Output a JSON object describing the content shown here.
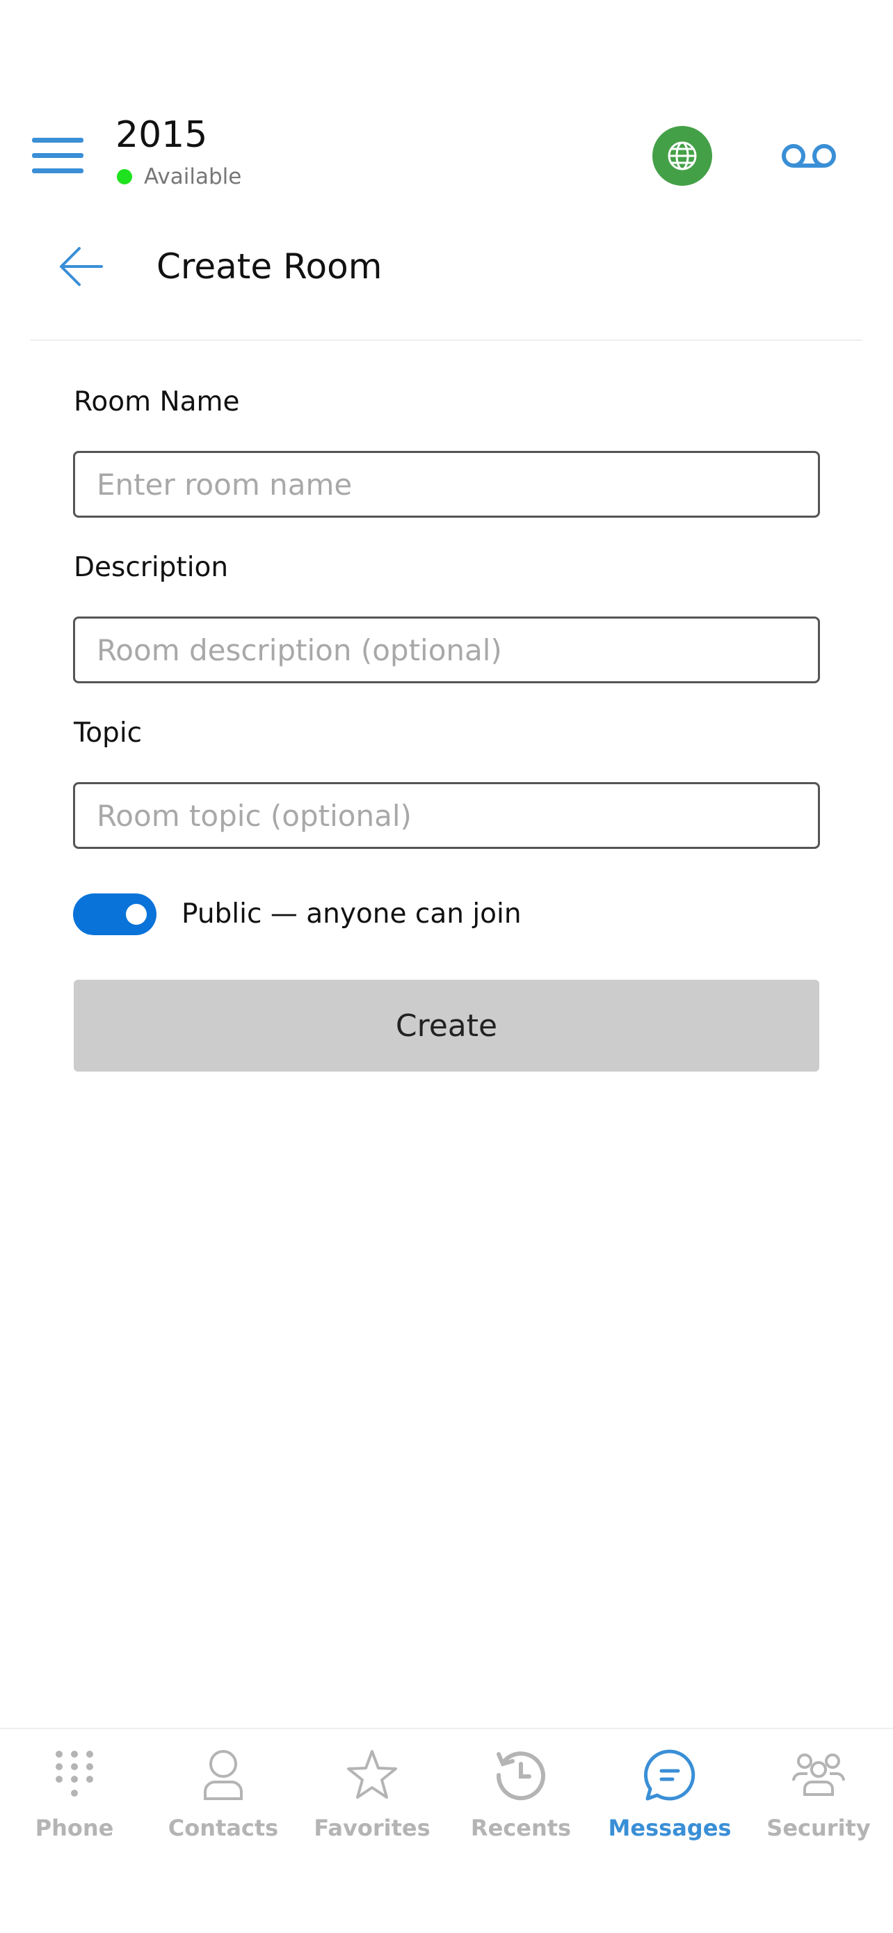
{
  "colors": {
    "accent": "#3a8fd6",
    "status_available": "#1fe21f",
    "globe_bg": "#44a047",
    "toggle_on": "#0a73d9",
    "button_disabled": "#cccccc",
    "tab_inactive": "#b4b4b4"
  },
  "header": {
    "extension": "2015",
    "status": "Available",
    "menu_icon": "hamburger-menu-icon",
    "globe_icon": "globe-icon",
    "voicemail_icon": "voicemail-icon"
  },
  "page": {
    "title": "Create Room",
    "back_icon": "arrow-left-icon"
  },
  "form": {
    "room_name": {
      "label": "Room Name",
      "placeholder": "Enter room name",
      "value": ""
    },
    "description": {
      "label": "Description",
      "placeholder": "Room description (optional)",
      "value": ""
    },
    "topic": {
      "label": "Topic",
      "placeholder": "Room topic (optional)",
      "value": ""
    },
    "public_toggle": {
      "label": "Public — anyone can join",
      "on": true
    },
    "create_label": "Create"
  },
  "tabs": [
    {
      "label": "Phone",
      "icon": "dialpad-icon",
      "active": false
    },
    {
      "label": "Contacts",
      "icon": "person-icon",
      "active": false
    },
    {
      "label": "Favorites",
      "icon": "star-icon",
      "active": false
    },
    {
      "label": "Recents",
      "icon": "history-icon",
      "active": false
    },
    {
      "label": "Messages",
      "icon": "chat-bubble-icon",
      "active": true
    },
    {
      "label": "Security",
      "icon": "group-icon",
      "active": false
    }
  ]
}
